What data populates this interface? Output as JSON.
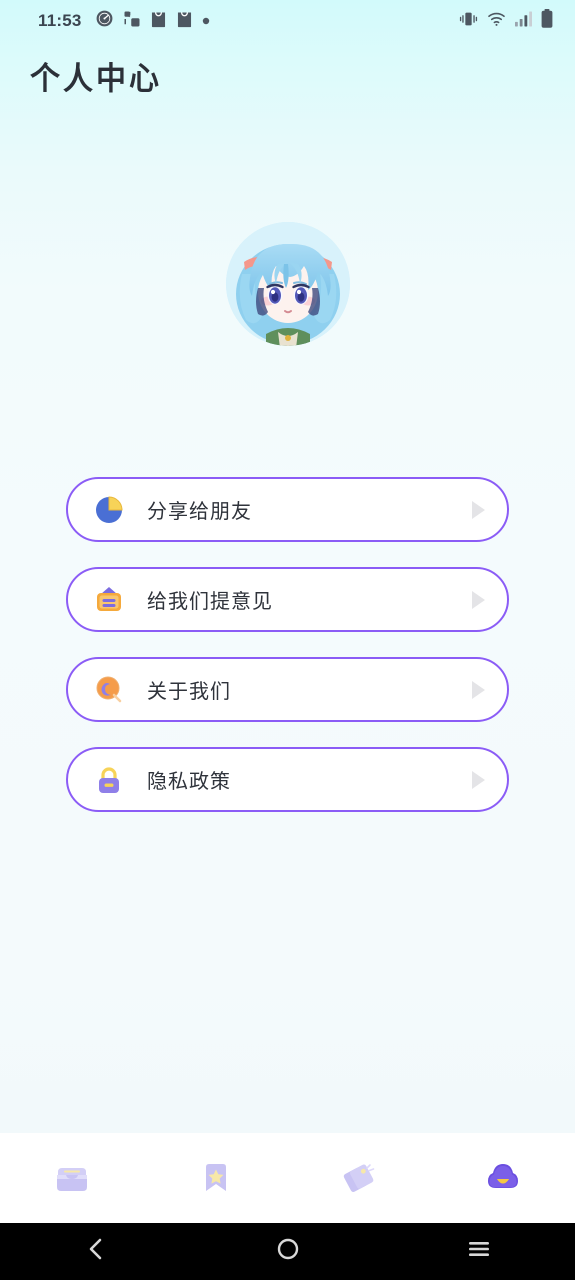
{
  "status_bar": {
    "time": "11:53",
    "left_icons": [
      "speedometer-icon",
      "network-share-icon",
      "shopping-bag-icon",
      "shopping-bag-icon",
      "dot-icon"
    ],
    "right_icons": [
      "vibrate-icon",
      "wifi-icon",
      "signal-bars-icon",
      "battery-icon"
    ]
  },
  "header": {
    "title": "个人中心"
  },
  "profile": {
    "avatar_alt": "anime-girl-avatar"
  },
  "menu": {
    "items": [
      {
        "label": "分享给朋友",
        "icon": "pie-chart-icon",
        "arrow": "chevron-right-icon"
      },
      {
        "label": "给我们提意见",
        "icon": "feedback-board-icon",
        "arrow": "chevron-right-icon"
      },
      {
        "label": "关于我们",
        "icon": "magnifier-icon",
        "arrow": "chevron-right-icon"
      },
      {
        "label": "隐私政策",
        "icon": "lock-icon",
        "arrow": "chevron-right-icon"
      }
    ]
  },
  "tabbar": {
    "items": [
      {
        "name": "inbox",
        "icon": "inbox-drawer-icon",
        "active": false
      },
      {
        "name": "favorites",
        "icon": "bookmark-star-icon",
        "active": false
      },
      {
        "name": "tags",
        "icon": "price-tags-icon",
        "active": false
      },
      {
        "name": "profile",
        "icon": "cloud-face-icon",
        "active": true
      }
    ]
  },
  "android_nav": {
    "back": "back-chevron-icon",
    "home": "home-circle-icon",
    "recents": "recents-menu-icon"
  },
  "colors": {
    "accent_purple": "#8b5cf6",
    "bg_top": "#d2fafb",
    "bg_bottom": "#f2f9fb",
    "card_white": "#ffffff",
    "text_dark": "#2f333b",
    "arrow_gray": "#e4e4e7",
    "tab_inactive": "#c7c4f2",
    "tab_active": "#6b4fe0",
    "icon_yellow": "#f5c842",
    "icon_orange": "#f5a93c"
  }
}
